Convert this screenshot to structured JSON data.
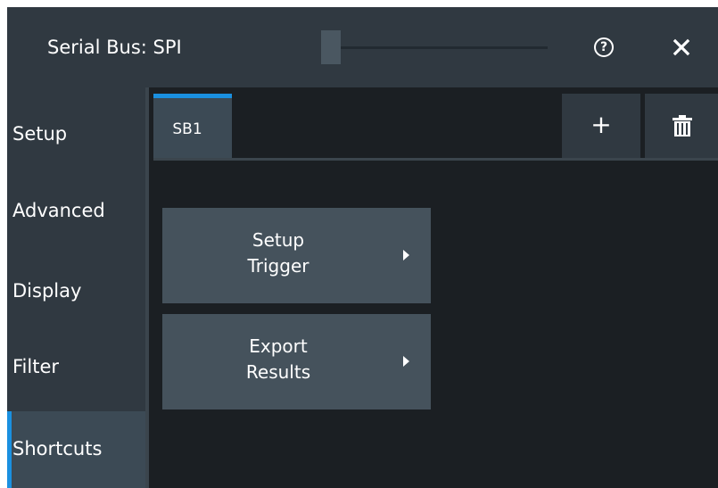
{
  "dialog": {
    "title": "Serial Bus: SPI",
    "help_icon": "help-circle-icon",
    "help_glyph": "?",
    "close_icon": "close-icon"
  },
  "sidebar": {
    "items": [
      {
        "label": "Setup",
        "active": false
      },
      {
        "label": "Advanced",
        "active": false
      },
      {
        "label": "Display",
        "active": false
      },
      {
        "label": "Filter",
        "active": false
      },
      {
        "label": "Shortcuts",
        "active": true
      }
    ]
  },
  "tabs": {
    "items": [
      {
        "label": "SB1",
        "active": true
      }
    ],
    "add_label": "+",
    "add_icon": "plus-icon",
    "delete_icon": "trash-icon"
  },
  "shortcuts": {
    "buttons": [
      {
        "line1": "Setup",
        "line2": "Trigger",
        "icon": "triangle-right-icon"
      },
      {
        "line1": "Export",
        "line2": "Results",
        "icon": "triangle-right-icon"
      }
    ]
  },
  "colors": {
    "background": "#1b1f23",
    "panel": "#303941",
    "button": "#45525c",
    "active_item": "#3c4a55",
    "accent": "#1a90e0",
    "text": "#ffffff"
  }
}
